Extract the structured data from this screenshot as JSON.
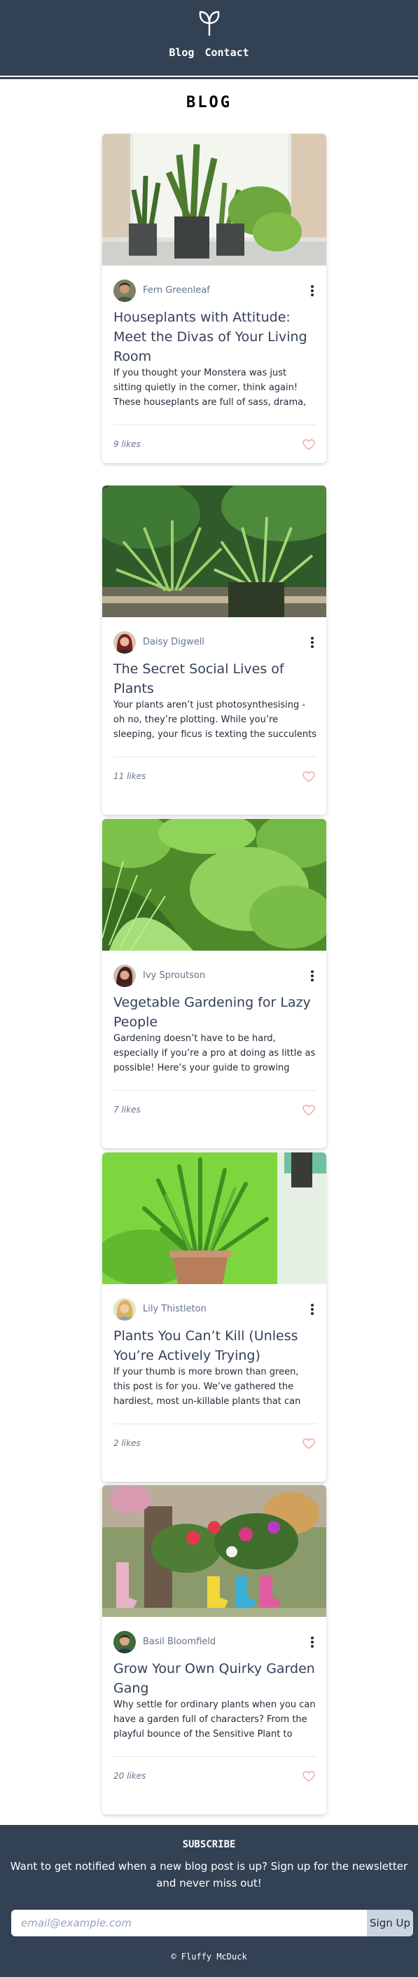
{
  "header": {
    "logo_icon": "sprout-icon",
    "nav": [
      {
        "label": "Blog"
      },
      {
        "label": "Contact"
      }
    ]
  },
  "page_title": "BLOG",
  "posts": [
    {
      "author": "Fern Greenleaf",
      "title": "Houseplants with Attitude: Meet the Divas of Your Living Room",
      "excerpt": "If you thought your Monstera was just sitting quietly in the corner, think again! These houseplants are full of sass, drama, and…",
      "likes": "9 likes",
      "image": "potted-houseplants-photo"
    },
    {
      "author": "Daisy Digwell",
      "title": "The Secret Social Lives of Plants",
      "excerpt": "Your plants aren’t just photosynthesising - oh no, they’re plotting. While you’re sleeping, your ficus is texting the succulents about th…",
      "likes": "11 likes",
      "image": "spider-plants-photo"
    },
    {
      "author": "Ivy Sproutson",
      "title": "Vegetable Gardening for Lazy People",
      "excerpt": "Gardening doesn’t have to be hard, especially if you’re a pro at doing as little as possible! Here’s your guide to growing veggies that…",
      "likes": "7 likes",
      "image": "lettuce-garden-photo"
    },
    {
      "author": "Lily Thistleton",
      "title": "Plants You Can’t Kill (Unless You’re Actively Trying)",
      "excerpt": "If your thumb is more brown than green, this post is for you. We’ve gathered the hardiest, most un-killable plants that can survive eve…",
      "likes": "2 likes",
      "image": "aloe-pot-photo"
    },
    {
      "author": "Basil Bloomfield",
      "title": "Grow Your Own Quirky Garden Gang",
      "excerpt": "Why settle for ordinary plants when you can have a garden full of characters? From the playful bounce of the Sensitive Plant to the…",
      "likes": "20 likes",
      "image": "boot-planters-photo"
    }
  ],
  "footer": {
    "subscribe_title": "SUBSCRIBE",
    "subscribe_text": "Want to get notified when a new blog post is up? Sign up for the newsletter and never miss out!",
    "email_placeholder": "email@example.com",
    "signup_label": "Sign Up",
    "copyright": "© Fluffy McDuck"
  }
}
